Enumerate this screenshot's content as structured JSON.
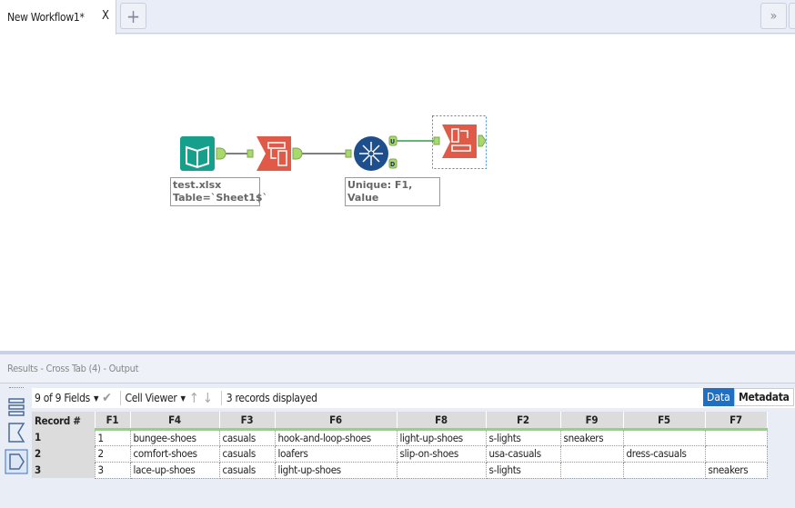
{
  "tabs": {
    "title": "New Workflow1*",
    "close": "X",
    "add": "+",
    "more": "»"
  },
  "canvas": {
    "input_annotation": [
      "test.xlsx",
      "Table=`Sheet1$`"
    ],
    "unique_annotation": "Unique: F1, Value",
    "unique_anchors": {
      "u": "U",
      "d": "D"
    }
  },
  "results": {
    "header": "Results - Cross Tab (4) - Output",
    "fields": "9 of 9 Fields",
    "viewer": "Cell Viewer",
    "records": "3 records displayed",
    "data_btn": "Data",
    "metadata_btn": "Metadata",
    "columns": [
      "Record #",
      "F1",
      "F4",
      "F3",
      "F6",
      "F8",
      "F2",
      "F9",
      "F5",
      "F7"
    ],
    "rows": [
      [
        "1",
        "1",
        "bungee-shoes",
        "casuals",
        "hook-and-loop-shoes",
        "light-up-shoes",
        "s-lights",
        "sneakers",
        "",
        ""
      ],
      [
        "2",
        "2",
        "comfort-shoes",
        "casuals",
        "loafers",
        "slip-on-shoes",
        "usa-casuals",
        "",
        "dress-casuals",
        ""
      ],
      [
        "3",
        "3",
        "lace-up-shoes",
        "casuals",
        "light-up-shoes",
        "",
        "s-lights",
        "",
        "",
        "sneakers"
      ]
    ]
  },
  "colors": {
    "accent": "#1f6fc5",
    "connector_ok": "#8fd67a"
  }
}
